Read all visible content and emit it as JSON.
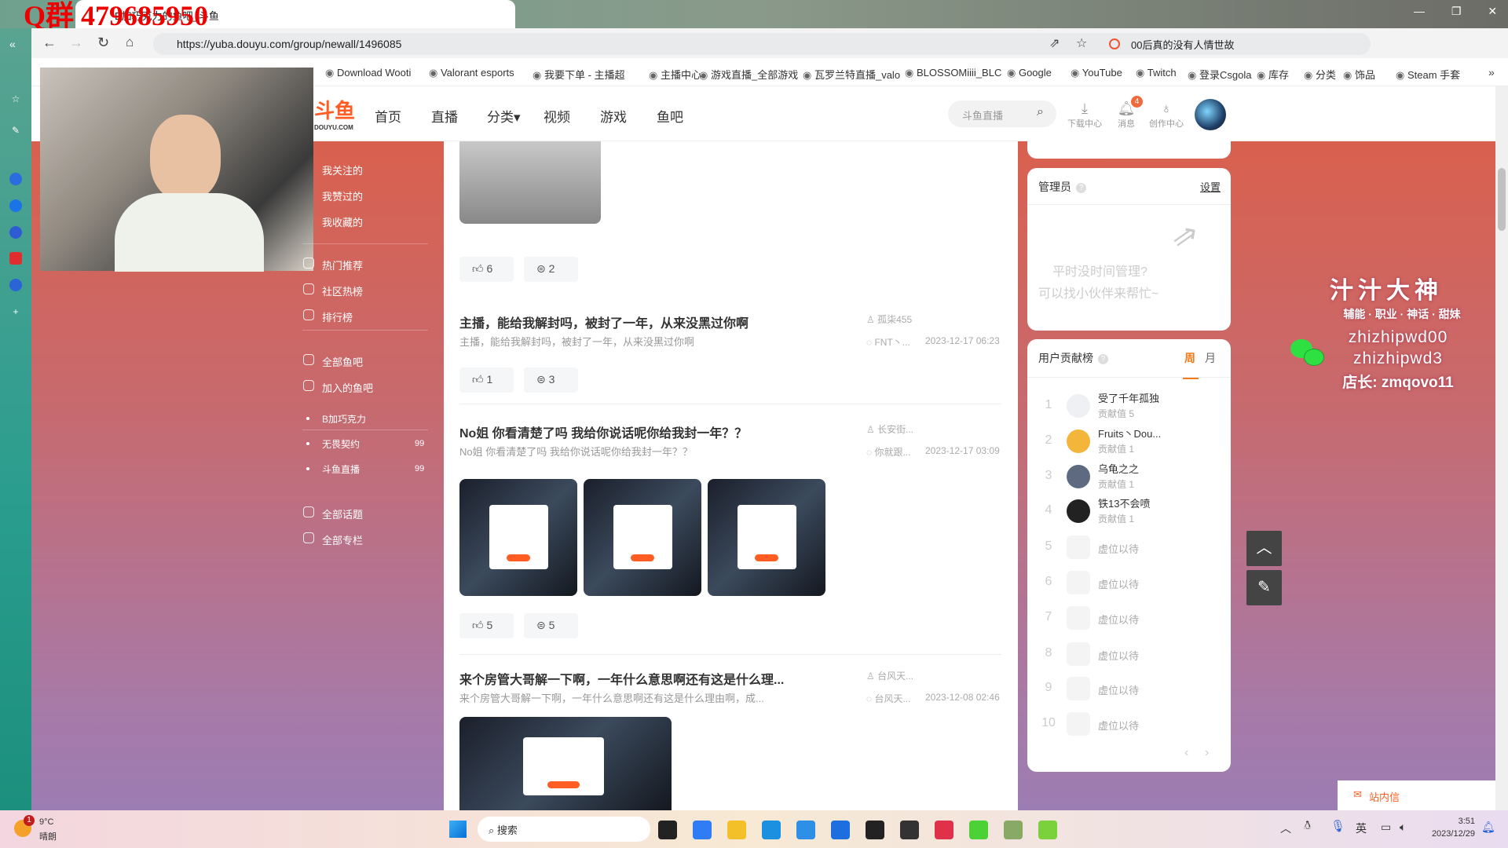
{
  "browser": {
    "watermark": "Q群 479685950",
    "tab_title": "B加巧克力的鱼吧_斗鱼",
    "url": "https://yuba.douyu.com/group/newall/1496085",
    "search_hint": "00后真的没有人情世故",
    "bookmarks": [
      "Download Wooti",
      "Valorant esports",
      "我要下单 - 主播超",
      "主播中心",
      "游戏直播_全部游戏",
      "瓦罗兰特直播_valo",
      "BLOSSOMiiii_BLC",
      "Google",
      "YouTube",
      "Twitch",
      "登录Csgola",
      "库存",
      "分类",
      "饰品",
      "Steam 手套"
    ],
    "more": "»"
  },
  "header": {
    "logo": "斗鱼",
    "logo_sub": "DOUYU.COM",
    "nav": [
      "首页",
      "直播",
      "分类▾",
      "视频",
      "游戏",
      "鱼吧"
    ],
    "search_placeholder": "斗鱼直播",
    "icons": [
      {
        "label": "下载中心",
        "icon": "download-icon"
      },
      {
        "label": "消息",
        "icon": "bell-icon"
      },
      {
        "label": "创作中心",
        "icon": "bulb-icon"
      }
    ],
    "message_badge": "4"
  },
  "left_nav": {
    "personal": [
      "我关注的",
      "我赞过的",
      "我收藏的"
    ],
    "discover": [
      "热门推荐",
      "社区热榜",
      "排行榜"
    ],
    "groups": [
      "全部鱼吧",
      "加入的鱼吧"
    ],
    "joined": [
      {
        "name": "B加巧克力",
        "count": ""
      },
      {
        "name": "无畏契约",
        "count": "99"
      },
      {
        "name": "斗鱼直播",
        "count": "99"
      }
    ],
    "topics": [
      "全部话题",
      "全部专栏"
    ]
  },
  "posts": [
    {
      "likes": "6",
      "comments": "2"
    },
    {
      "title": "主播，能给我解封吗，被封了一年，从来没黑过你啊",
      "summary": "主播，能给我解封吗，被封了一年，从来没黑过你啊",
      "author": "孤柒455",
      "replier": "FNT丶...",
      "date": "2023-12-17 06:23",
      "likes": "1",
      "comments": "3"
    },
    {
      "title": "No姐 你看清楚了吗 我给你说话呢你给我封一年？？",
      "summary": "No姐 你看清楚了吗 我给你说话呢你给我封一年？？",
      "author": "长安街...",
      "replier": "你就跟...",
      "date": "2023-12-17 03:09",
      "likes": "5",
      "comments": "5"
    },
    {
      "title": "来个房管大哥解一下啊，一年什么意思啊还有这是什么理...",
      "summary": "来个房管大哥解一下啊，一年什么意思啊还有这是什么理由啊，成...",
      "author": "台风天...",
      "replier": "台风天...",
      "date": "2023-12-08 02:46"
    }
  ],
  "admin": {
    "title": "管理员",
    "help": "?",
    "settings": "设置",
    "empty_line1": "平时没时间管理?",
    "empty_line2": "可以找小伙伴来帮忙~"
  },
  "contrib": {
    "title": "用户贡献榜",
    "tabs": [
      "周",
      "月"
    ],
    "value_label": "贡献值",
    "rows": [
      {
        "rank": "1",
        "name": "受了千年孤独",
        "value": "5"
      },
      {
        "rank": "2",
        "name": "Fruits丶Dou...",
        "value": "1"
      },
      {
        "rank": "3",
        "name": "乌龟之之",
        "value": "1"
      },
      {
        "rank": "4",
        "name": "铁13不会喷",
        "value": "1"
      },
      {
        "rank": "5",
        "name": "虚位以待"
      },
      {
        "rank": "6",
        "name": "虚位以待"
      },
      {
        "rank": "7",
        "name": "虚位以待"
      },
      {
        "rank": "8",
        "name": "虚位以待"
      },
      {
        "rank": "9",
        "name": "虚位以待"
      },
      {
        "rank": "10",
        "name": "虚位以待"
      }
    ],
    "prev": "‹",
    "next": "›"
  },
  "promo": {
    "name": "汁汁大神",
    "tags": "辅能 · 职业 · 神话 · 甜妹",
    "id1": "zhizhipwd00",
    "id2": "zhizhipwd3",
    "shop": "店长: zmqovo11"
  },
  "float": {
    "top": "︿",
    "edit": "✎",
    "inbox": "站内信"
  },
  "taskbar": {
    "weather_temp": "9°C",
    "weather_desc": "晴朗",
    "weather_badge": "1",
    "search": "搜索",
    "ime": "英",
    "time": "3:51",
    "date": "2023/12/29"
  },
  "colors": {
    "accent": "#ff5d23",
    "tab_active": "#f07a1c",
    "wechat": "#2fe043"
  }
}
